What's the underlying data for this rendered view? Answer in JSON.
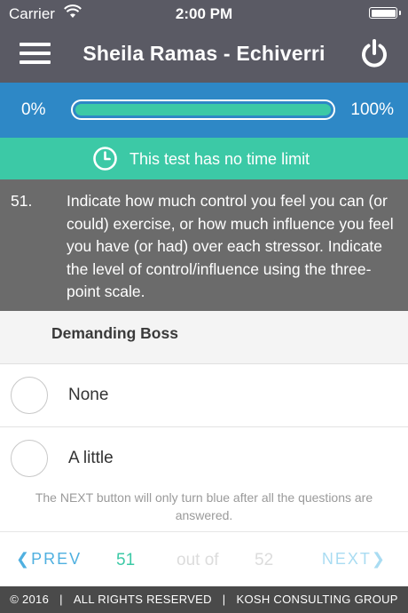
{
  "status_bar": {
    "carrier": "Carrier",
    "time": "2:00 PM"
  },
  "nav": {
    "title": "Sheila Ramas - Echiverri"
  },
  "progress": {
    "left_label": "0%",
    "right_label": "100%",
    "value_percent": 100,
    "fill_color": "#3cc9a6",
    "bar_color": "#2e88c6"
  },
  "time_banner": {
    "message": "This test has no time limit",
    "color": "#3cc9a6"
  },
  "question": {
    "number": "51.",
    "text": "Indicate how much control you feel you can (or could) exercise, or how much influence you feel you have (or had) over each stressor. Indicate the level of control/influence using the three-point scale."
  },
  "subject": {
    "label": "Demanding Boss"
  },
  "options": [
    {
      "label": "None"
    },
    {
      "label": "A little"
    }
  ],
  "note": "The NEXT button will only turn blue after all the questions are answered.",
  "pager": {
    "prev_label": "PREV",
    "current": "51",
    "out_of": "out of",
    "total": "52",
    "next_label": "NEXT"
  },
  "footer": {
    "copyright": "© 2016",
    "rights": "ALL RIGHTS RESERVED",
    "company": "KOSH CONSULTING GROUP",
    "separator": "|"
  },
  "icons": {
    "wifi": "wifi-icon",
    "battery": "battery-icon",
    "menu": "hamburger-menu-icon",
    "power": "power-icon",
    "clock": "clock-icon"
  }
}
